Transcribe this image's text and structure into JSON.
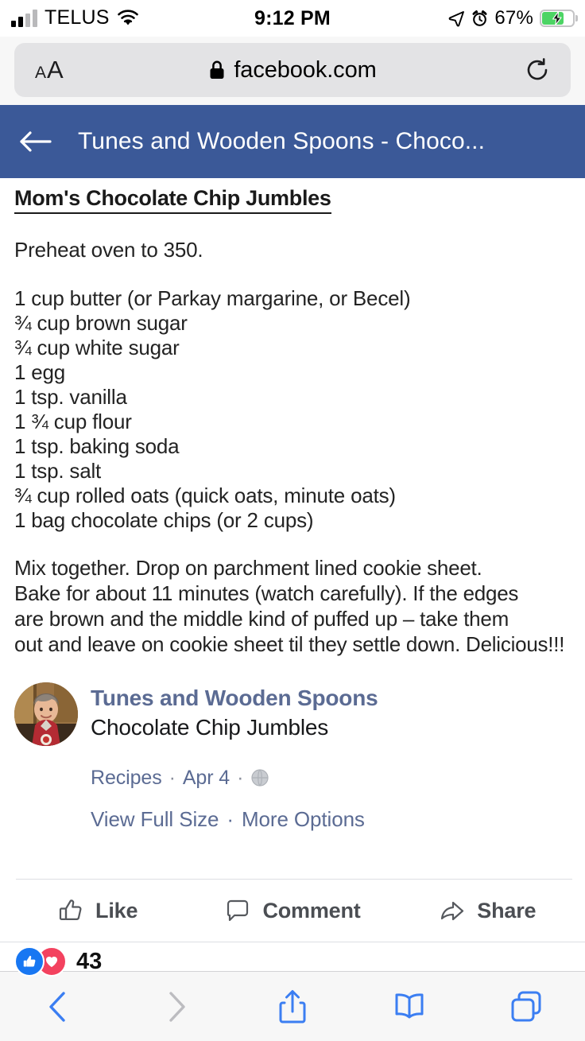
{
  "status_bar": {
    "carrier": "TELUS",
    "time": "9:12 PM",
    "battery_percent": "67%",
    "icons": {
      "signal": "signal-bars-icon",
      "wifi": "wifi-icon",
      "location": "location-arrow-icon",
      "alarm": "alarm-clock-icon",
      "battery": "battery-charging-icon"
    }
  },
  "browser": {
    "text_size_button": "AA",
    "url": "facebook.com",
    "lock_icon": "lock-icon",
    "reload_icon": "reload-icon",
    "toolbar": {
      "back": "chevron-left-icon",
      "forward": "chevron-right-icon",
      "share": "share-icon",
      "bookmarks": "book-icon",
      "tabs": "tabs-icon"
    }
  },
  "fb_header": {
    "back_icon": "arrow-left-icon",
    "title": "Tunes and Wooden Spoons - Choco...",
    "background_color": "#3b5998"
  },
  "recipe": {
    "title": "Mom's Chocolate Chip Jumbles",
    "preheat": "Preheat oven to 350.",
    "ingredients": [
      "1 cup butter (or Parkay margarine, or Becel)",
      "¾ cup brown sugar",
      "¾ cup white sugar",
      "1 egg",
      "1 tsp. vanilla",
      "1 ¾ cup flour",
      "1 tsp. baking soda",
      "1 tsp. salt",
      "¾ cup rolled oats (quick oats, minute oats)",
      "1 bag chocolate chips (or 2 cups)"
    ],
    "instructions": [
      "Mix together.  Drop on parchment lined cookie sheet.",
      "Bake for about 11 minutes (watch carefully). If the edges",
      "are brown and the middle kind of puffed up – take them",
      "out and leave on cookie sheet til they settle down.  Delicious!!!"
    ]
  },
  "post": {
    "page_name": "Tunes and Wooden Spoons",
    "caption": "Chocolate Chip Jumbles",
    "album": "Recipes",
    "date": "Apr 4",
    "privacy_icon": "globe-icon",
    "separator": "·",
    "view_full_size": "View Full Size",
    "more_options": "More Options",
    "page_name_color": "#5b6b93"
  },
  "actions": {
    "like": "Like",
    "comment": "Comment",
    "share": "Share",
    "like_icon": "thumbs-up-icon",
    "comment_icon": "comment-bubble-icon",
    "share_icon": "share-arrow-icon"
  },
  "reactions": {
    "count": "43",
    "like_badge": "like-reaction-icon",
    "love_badge": "love-reaction-icon",
    "like_color": "#1877f2",
    "love_color": "#f3425f"
  }
}
